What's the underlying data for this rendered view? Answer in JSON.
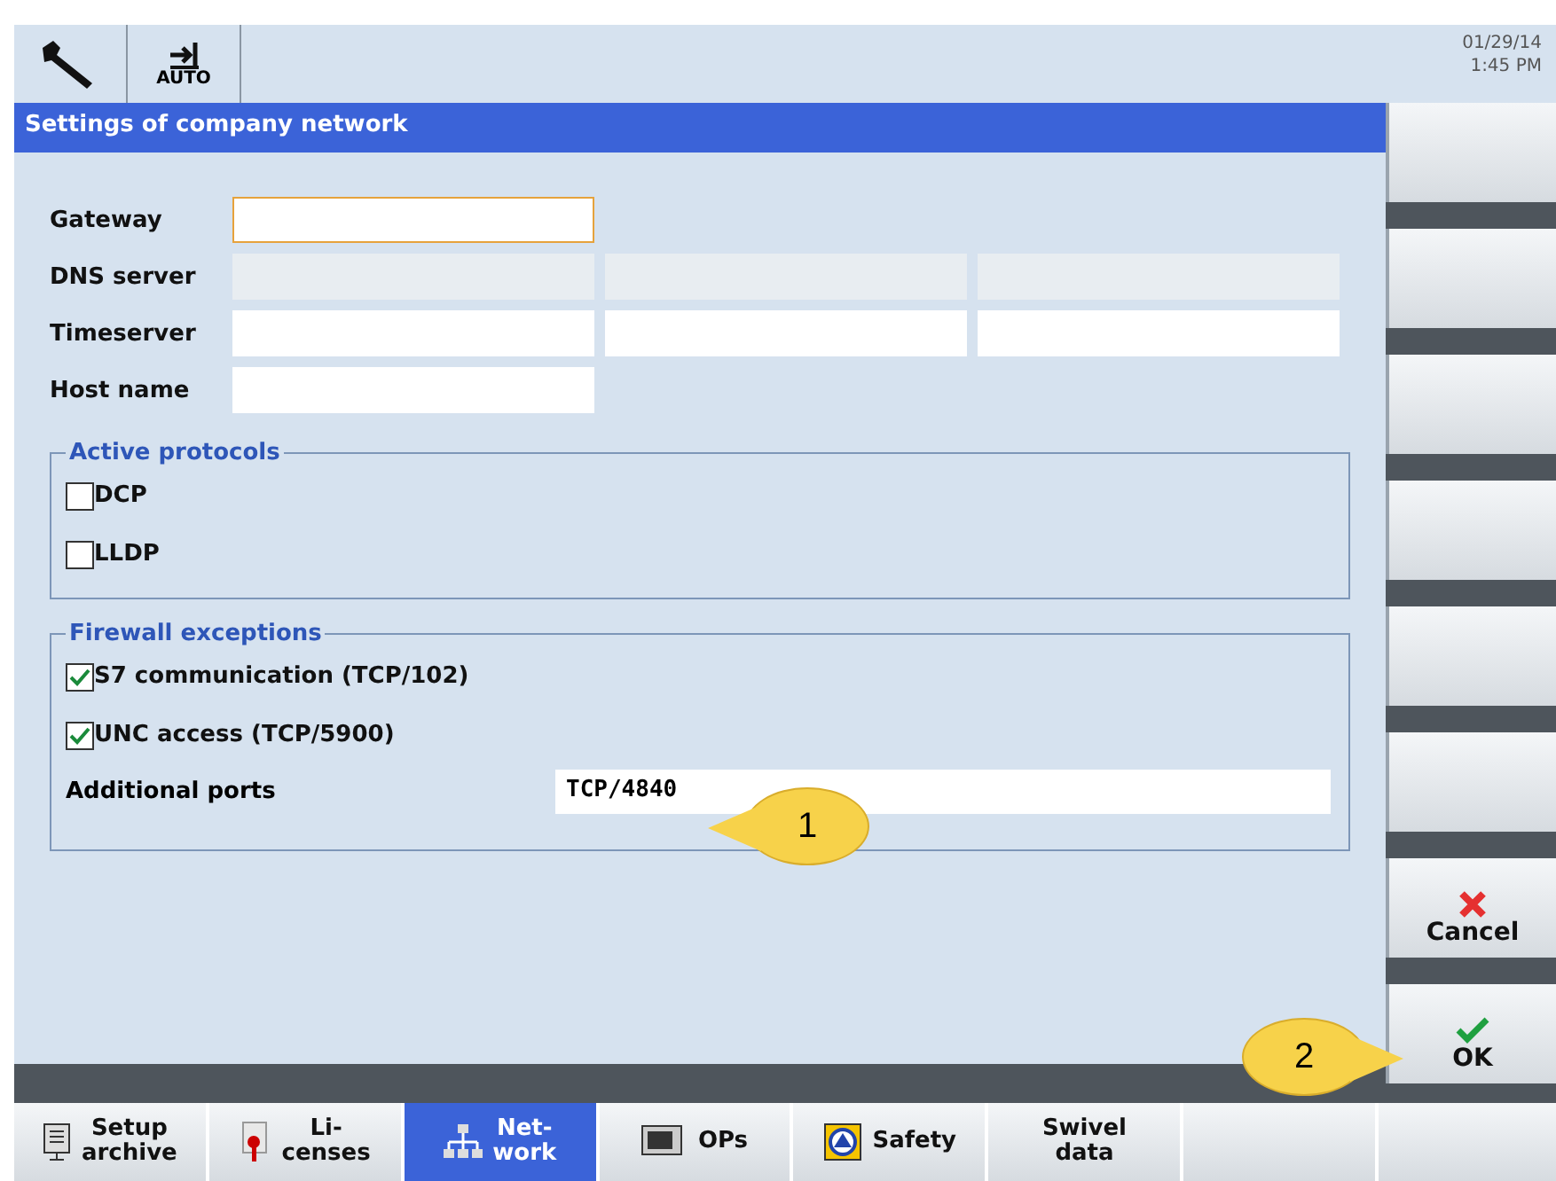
{
  "header": {
    "mode_label": "AUTO",
    "date": "01/29/14",
    "time": "1:45 PM"
  },
  "title": "Settings of company network",
  "fields": [
    {
      "label": "Gateway",
      "inputs": [
        {
          "disabled": false,
          "focused": true
        }
      ]
    },
    {
      "label": "DNS server",
      "inputs": [
        {
          "disabled": true,
          "focused": false
        },
        {
          "disabled": true,
          "focused": false
        },
        {
          "disabled": true,
          "focused": false
        }
      ]
    },
    {
      "label": "Timeserver",
      "inputs": [
        {
          "disabled": false,
          "focused": false
        },
        {
          "disabled": false,
          "focused": false
        },
        {
          "disabled": false,
          "focused": false
        }
      ]
    },
    {
      "label": "Host name",
      "inputs": [
        {
          "disabled": false,
          "focused": false
        }
      ]
    }
  ],
  "groups": [
    {
      "title": "Active protocols",
      "options": [
        {
          "label": "DCP",
          "checked": false
        },
        {
          "label": "LLDP",
          "checked": false
        }
      ]
    },
    {
      "title": "Firewall exceptions",
      "options": [
        {
          "label": "S7 communication (TCP/102)",
          "checked": true
        },
        {
          "label": "UNC access (TCP/5900)",
          "checked": true
        }
      ],
      "port": {
        "label": "Additional ports",
        "value": "TCP/4840"
      }
    }
  ],
  "softkeys": [
    {
      "kind": "blank"
    },
    {
      "kind": "blank"
    },
    {
      "kind": "blank"
    },
    {
      "kind": "blank"
    },
    {
      "kind": "blank"
    },
    {
      "kind": "blank"
    },
    {
      "kind": "cancel",
      "label": "Cancel"
    },
    {
      "kind": "ok",
      "label": "OK"
    }
  ],
  "tabs": [
    {
      "kind": "archive",
      "lines": [
        "Setup",
        "archive"
      ],
      "selected": false
    },
    {
      "kind": "license",
      "lines": [
        "Li-",
        "censes"
      ],
      "selected": false
    },
    {
      "kind": "network",
      "lines": [
        "Net-",
        "work"
      ],
      "selected": true
    },
    {
      "kind": "panel",
      "lines": [
        "OPs"
      ],
      "selected": false
    },
    {
      "kind": "safety",
      "lines": [
        "Safety"
      ],
      "selected": false
    },
    {
      "kind": "text",
      "lines": [
        "Swivel",
        "data"
      ],
      "selected": false
    },
    {
      "kind": "blank",
      "selected": false
    },
    {
      "kind": "blank",
      "selected": false
    }
  ],
  "callouts": [
    {
      "text": "1"
    },
    {
      "text": "2"
    }
  ]
}
